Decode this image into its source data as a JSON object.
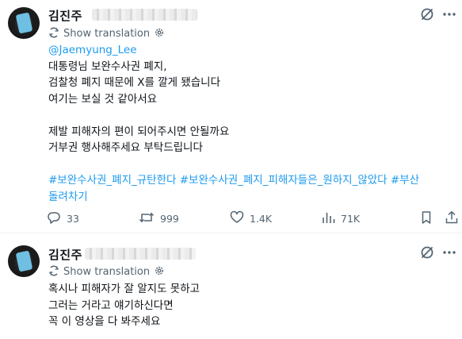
{
  "colors": {
    "link": "#1d9bf0",
    "muted": "#536471",
    "text": "#0f1419",
    "divider": "#eff3f4"
  },
  "tweets": [
    {
      "author_name": "김진주",
      "translate_label": "Show translation",
      "mention": "@Jaemyung_Lee",
      "lines": [
        "대통령님 보완수사권 폐지,",
        "검찰청 폐지 때문에 X를 깔게 됐습니다",
        "여기는 보실 것 같아서요",
        "",
        "제발 피해자의 편이 되어주시면 안될까요",
        "거부권 행사해주세요 부탁드립니다",
        ""
      ],
      "hashtag_lines": [
        "#보완수사권_폐지_규탄한다 #보완수사권_폐지_피해자들은_원하지_않았다 #부산",
        "돌려차기"
      ],
      "actions": {
        "replies": "33",
        "reposts": "999",
        "likes": "1.4K",
        "views": "71K"
      }
    },
    {
      "author_name": "김진주",
      "translate_label": "Show translation",
      "lines": [
        "혹시나 피해자가 잘 알지도 못하고",
        "그러는 거라고 얘기하신다면",
        "꼭 이 영상을 다 봐주세요"
      ]
    }
  ]
}
